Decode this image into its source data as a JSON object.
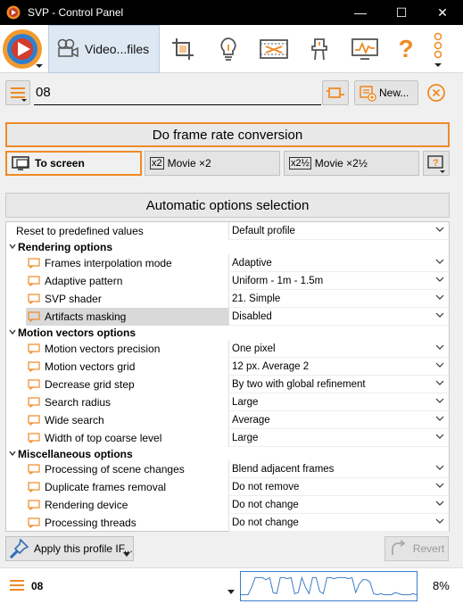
{
  "window": {
    "title": "SVP - Control Panel",
    "minimize": "—",
    "maximize": "☐",
    "close": "✕"
  },
  "toolbar": {
    "active_tab_label": "Video...files",
    "buttons": [
      "crop-icon",
      "lightbulb-icon",
      "filmstrip-icon",
      "device-icon",
      "monitor-chart-icon",
      "help-icon",
      "more-icon"
    ],
    "help_label": "?",
    "accent": "#f08a24"
  },
  "profile": {
    "name": "08",
    "new_label": "New..."
  },
  "frame_rate_button": "Do frame rate conversion",
  "modes": {
    "to_screen": "To screen",
    "movie_x2_badge": "x2",
    "movie_x2": "Movie ×2",
    "movie_x2_5_badge": "x2½",
    "movie_x2_5": "Movie ×2½",
    "help_label": "?"
  },
  "auto_options_button": "Automatic options selection",
  "options": {
    "reset": {
      "label": "Reset to predefined values",
      "value": "Default profile"
    },
    "rendering": {
      "title": "Rendering options",
      "items": [
        {
          "label": "Frames interpolation mode",
          "value": "Adaptive"
        },
        {
          "label": "Adaptive pattern",
          "value": "Uniform - 1m - 1.5m"
        },
        {
          "label": "SVP shader",
          "value": "21. Simple"
        },
        {
          "label": "Artifacts masking",
          "value": "Disabled"
        }
      ]
    },
    "motion": {
      "title": "Motion vectors options",
      "items": [
        {
          "label": "Motion vectors precision",
          "value": "One pixel"
        },
        {
          "label": "Motion vectors grid",
          "value": "12 px. Average 2"
        },
        {
          "label": "Decrease grid step",
          "value": "By two with global refinement"
        },
        {
          "label": "Search radius",
          "value": "Large"
        },
        {
          "label": "Wide search",
          "value": "Average"
        },
        {
          "label": "Width of top coarse level",
          "value": "Large"
        }
      ]
    },
    "misc": {
      "title": "Miscellaneous options",
      "items": [
        {
          "label": "Processing of scene changes",
          "value": "Blend adjacent frames"
        },
        {
          "label": "Duplicate frames removal",
          "value": "Do not remove"
        },
        {
          "label": "Rendering device",
          "value": "Do not change"
        },
        {
          "label": "Processing threads",
          "value": "Do not change"
        }
      ]
    }
  },
  "apply_button": "Apply this profile IF...",
  "revert_button": "Revert",
  "status": {
    "profile": "08",
    "cpu_percent": "8%",
    "cpu_graph": [
      2,
      2,
      2,
      9,
      18,
      18,
      18,
      16,
      18,
      4,
      3,
      18,
      18,
      17,
      18,
      3,
      4,
      18,
      9,
      3,
      18,
      18,
      5,
      3,
      18,
      18,
      17,
      18,
      18,
      18,
      17,
      18,
      4,
      12,
      16,
      16,
      14,
      3,
      2,
      3,
      2,
      2,
      2,
      4,
      3,
      2,
      2,
      2,
      3,
      2
    ]
  }
}
